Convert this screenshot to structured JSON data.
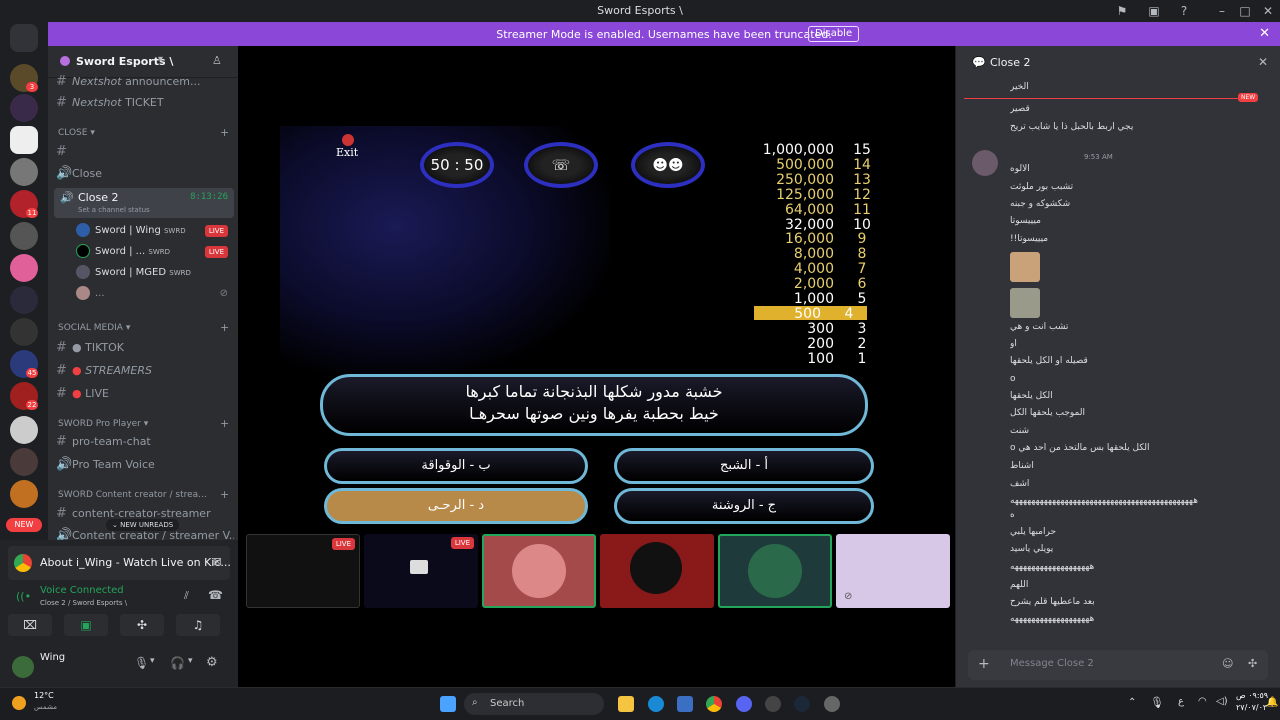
{
  "window": {
    "title": "Sword Esports \\"
  },
  "banner": {
    "message": "Streamer Mode is enabled. Usernames have been truncated.",
    "button": "Disable"
  },
  "server": {
    "name": "Sword Esports \\"
  },
  "channels": {
    "top1": "announcem...",
    "top1_prefix": "Nextshot",
    "top2": "TICKET",
    "top2_prefix": "Nextshot",
    "close_cat": "CLOSE",
    "close_ch": "Close",
    "close2": "Close 2",
    "close2_time": "8:13:26",
    "close2_status": "Set a channel status",
    "social_cat": "SOCIAL MEDIA",
    "tiktok": "TIKTOK",
    "streamers": "STREAMERS",
    "live": "LIVE",
    "pro_cat": "SWORD Pro Player",
    "pro_chat": "pro-team-chat",
    "pro_voice": "Pro Team Voice",
    "creator_cat": "SWORD Content creator / strea...",
    "creator_ch": "content-creator-streamer",
    "creator_ch2": "Content creator / streamer V...",
    "new_unreads": "NEW UNREADS"
  },
  "voice_users": [
    {
      "name": "Sword | Wing",
      "tag": "SWRD",
      "live": "LIVE"
    },
    {
      "name": "Sword | ...",
      "tag": "SWRD",
      "live": "LIVE"
    },
    {
      "name": "Sword | MGED",
      "tag": "SWRD",
      "live": ""
    },
    {
      "name": "...",
      "tag": "",
      "live": ""
    }
  ],
  "panel": {
    "activity": "About i_Wing - Watch Live on Kic...",
    "voice_status": "Voice Connected",
    "voice_channel": "Close 2 / Sword Esports \\",
    "username": "Wing",
    "new_label": "NEW"
  },
  "game": {
    "exit": "Exit",
    "fifty": "50 : 50",
    "ladder": [
      {
        "amt": "1,000,000",
        "lvl": "15"
      },
      {
        "amt": "500,000",
        "lvl": "14"
      },
      {
        "amt": "250,000",
        "lvl": "13"
      },
      {
        "amt": "125,000",
        "lvl": "12"
      },
      {
        "amt": "64,000",
        "lvl": "11"
      },
      {
        "amt": "32,000",
        "lvl": "10"
      },
      {
        "amt": "16,000",
        "lvl": "9"
      },
      {
        "amt": "8,000",
        "lvl": "8"
      },
      {
        "amt": "4,000",
        "lvl": "7"
      },
      {
        "amt": "2,000",
        "lvl": "6"
      },
      {
        "amt": "1,000",
        "lvl": "5"
      },
      {
        "amt": "500",
        "lvl": "4"
      },
      {
        "amt": "300",
        "lvl": "3"
      },
      {
        "amt": "200",
        "lvl": "2"
      },
      {
        "amt": "100",
        "lvl": "1"
      }
    ],
    "question_line1": "خشبة مدور شكلها      البذنجانة تماما كبرها",
    "question_line2": "خيط بحطبة يفرها      ونين صوتها سحرهـا",
    "answer_a": "أ - الشبج",
    "answer_b": "ب - الوقواقة",
    "answer_c": "ج - الروشنة",
    "answer_d": "د - الرحـى"
  },
  "streams": [
    {
      "live": "LIVE"
    },
    {
      "live": "LIVE"
    }
  ],
  "chat": {
    "header": "Close 2",
    "new_tag": "NEW",
    "time": "9:53 AM",
    "placeholder": "Message Close 2",
    "lines": [
      "الخير",
      "قصير",
      "يجي اربط بالحبل ذا يا شايب تريح",
      "الالوه",
      "تشبب بور ملوثت",
      "شكشوكه و جبنه",
      "ميييسوتا",
      "ميييسوتا!!",
      "تشب انت و هي",
      "او",
      "قصيله او الكل يلحقها",
      "o",
      "الكل يلحقها",
      "الموجب يلحقها الكل",
      "شنت",
      "الكل يلحقها بس مالتحذ من احد هي o",
      "اشناط",
      "اشف",
      "ههههههههههههههههههههههههههههههههههههههههههههه",
      "ه",
      "حرامبها يلبي",
      "يويلي ياسيد",
      "هههههههههههههههههههه",
      "اللهم",
      "بعد ماعطيها قلم يشرح",
      "هههههههههههههههههههه"
    ]
  },
  "taskbar": {
    "weather_temp": "12°C",
    "weather_desc": "مشمس",
    "search": "Search",
    "clock_time": "٠٩:٥٩ ص",
    "clock_date": "٢٧/٠٧/٠٣",
    "lang": "ع"
  },
  "colors": {
    "accent": "#5865f2",
    "banner": "#8b47d8",
    "live": "#da373c",
    "voice": "#23a55a",
    "ladder_gold": "#e0b12c"
  }
}
